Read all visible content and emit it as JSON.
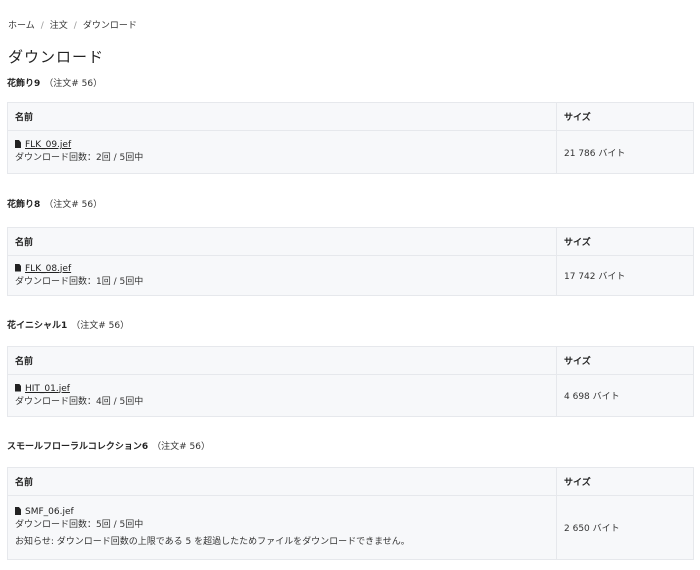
{
  "breadcrumb": {
    "items": [
      "ホーム",
      "注文",
      "ダウンロード"
    ],
    "separator": "/"
  },
  "page_title": "ダウンロード",
  "table_headers": {
    "name": "名前",
    "size": "サイズ"
  },
  "sections": [
    {
      "title": "花飾り9",
      "order": "（注文# 56）",
      "file_name": "FLK_09.jef",
      "download_count": "ダウンロード回数：2回 / 5回中",
      "size": "21 786 バイト"
    },
    {
      "title": "花飾り8",
      "order": "（注文# 56）",
      "file_name": "FLK_08.jef",
      "download_count": "ダウンロード回数：1回 / 5回中",
      "size": "17 742 バイト"
    },
    {
      "title": "花イニシャル1",
      "order": "（注文# 56）",
      "file_name": "HIT_01.jef",
      "download_count": "ダウンロード回数：4回 / 5回中",
      "size": "4 698 バイト"
    },
    {
      "title": "スモールフローラルコレクション6",
      "order": "（注文# 56）",
      "file_name": "SMF_06.jef",
      "download_count": "ダウンロード回数：5回 / 5回中",
      "notice": "お知らせ: ダウンロード回数の上限である 5 を超過したためファイルをダウンロードできません。",
      "size": "2 650 バイト"
    }
  ]
}
